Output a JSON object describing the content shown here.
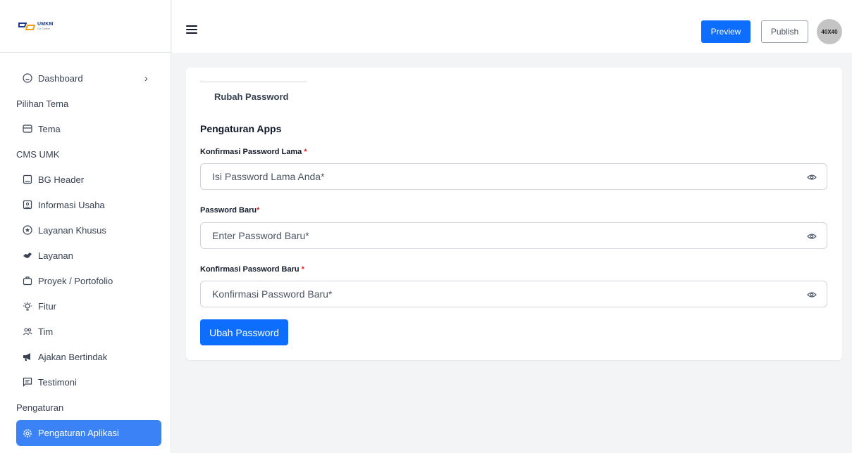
{
  "brand": {
    "logo_line1": "UMKM",
    "logo_line2": "Go Online"
  },
  "sidebar": {
    "dashboard": "Dashboard",
    "section_tema": "Pilihan Tema",
    "tema": "Tema",
    "section_cms": "CMS UMK",
    "bg_header": "BG Header",
    "informasi_usaha": "Informasi Usaha",
    "layanan_khusus": "Layanan Khusus",
    "layanan": "Layanan",
    "proyek": "Proyek / Portofolio",
    "fitur": "Fitur",
    "tim": "Tim",
    "ajakan": "Ajakan Bertindak",
    "testimoni": "Testimoni",
    "section_pengaturan": "Pengaturan",
    "pengaturan_aplikasi": "Pengaturan Aplikasi"
  },
  "header": {
    "preview_label": "Preview",
    "publish_label": "Publish",
    "avatar_text": "40X40"
  },
  "card": {
    "tab_label": "Rubah Password",
    "section_title": "Pengaturan Apps",
    "field_old": {
      "label": "Konfirmasi Password Lama ",
      "required": "*",
      "placeholder": "Isi Password Lama Anda*"
    },
    "field_new": {
      "label": "Password Baru",
      "required": "*",
      "placeholder": "Enter Password Baru*"
    },
    "field_confirm": {
      "label": "Konfirmasi Password Baru ",
      "required": "*",
      "placeholder": "Konfirmasi Password Baru*"
    },
    "submit_label": "Ubah Password"
  },
  "colors": {
    "primary": "#0d6efd",
    "sidebar_active": "#3b82f6",
    "required": "#dc2626"
  }
}
